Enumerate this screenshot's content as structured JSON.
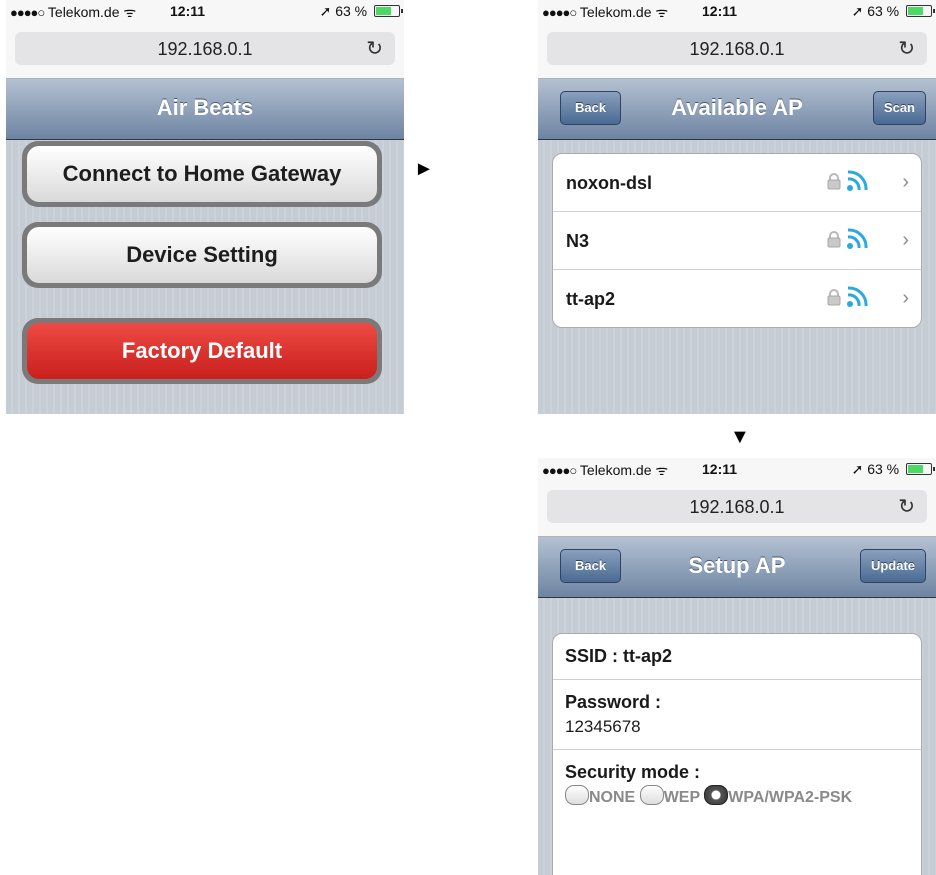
{
  "status_bar": {
    "carrier_dots": "●●●●○",
    "carrier": "Telekom.de",
    "wifi_glyph": "ᯤ",
    "time": "12:11",
    "location_glyph": "➚",
    "battery": "63 %",
    "battery_level": 0.63
  },
  "browser": {
    "url": "192.168.0.1",
    "reload_glyph": "↻"
  },
  "screen1": {
    "title": "Air Beats",
    "buttons": {
      "connect": "Connect to Home Gateway",
      "device_setting": "Device Setting",
      "factory_default": "Factory Default"
    }
  },
  "screen2": {
    "back": "Back",
    "title": "Available AP",
    "scan": "Scan",
    "networks": [
      "noxon-dsl",
      "N3",
      "tt-ap2"
    ]
  },
  "screen3": {
    "back": "Back",
    "title": "Setup AP",
    "update": "Update",
    "ssid_label": "SSID : tt-ap2",
    "password_label": "Password :",
    "password_value": "12345678",
    "security_label": "Security mode :",
    "security_options": [
      "NONE",
      "WEP",
      "WPA/WPA2-PSK"
    ],
    "security_selected": "WPA/WPA2-PSK"
  },
  "arrows": {
    "right": "►",
    "down": "▼"
  },
  "colors": {
    "nav_gradient_top": "#b4c1d2",
    "nav_gradient_bottom": "#6d84a2",
    "factory_red": "#d9302b",
    "wifi_blue": "#2aa8e0",
    "page_background": "#c5ccd4"
  },
  "icons": [
    "lock-icon",
    "wifi-signal-icon",
    "chevron-right-icon",
    "reload-icon",
    "location-icon",
    "battery-icon"
  ]
}
